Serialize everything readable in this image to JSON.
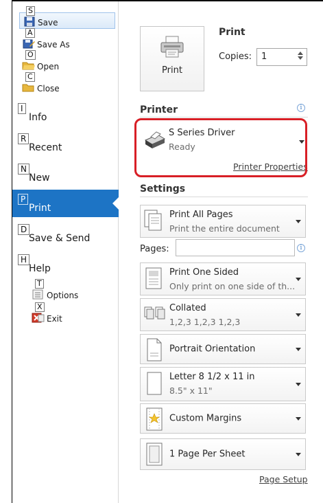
{
  "quick_access": [
    {
      "key": "S",
      "label": "Save",
      "icon": "save-icon",
      "selected": true
    },
    {
      "key": "A",
      "label": "Save As",
      "icon": "save-as-icon"
    },
    {
      "key": "O",
      "label": "Open",
      "icon": "folder-open-icon"
    },
    {
      "key": "C",
      "label": "Close",
      "icon": "folder-close-icon"
    }
  ],
  "nav": [
    {
      "key": "I",
      "label": "Info"
    },
    {
      "key": "R",
      "label": "Recent"
    },
    {
      "key": "N",
      "label": "New"
    },
    {
      "key": "P",
      "label": "Print",
      "active": true
    },
    {
      "key": "D",
      "label": "Save & Send"
    },
    {
      "key": "H",
      "label": "Help"
    }
  ],
  "sub_items": [
    {
      "key": "T",
      "label": "Options",
      "icon": "options-icon"
    },
    {
      "key": "X",
      "label": "Exit",
      "icon": "exit-icon"
    }
  ],
  "print": {
    "button_label": "Print",
    "title": "Print",
    "copies_label": "Copies:",
    "copies_value": "1"
  },
  "printer": {
    "heading": "Printer",
    "info_glyph": "i",
    "name": "S Series Driver",
    "status": "Ready",
    "properties_link": "Printer Properties"
  },
  "settings": {
    "heading": "Settings",
    "print_range": {
      "title": "Print All Pages",
      "subtitle": "Print the entire document"
    },
    "pages_label": "Pages:",
    "pages_value": "",
    "sides": {
      "title": "Print One Sided",
      "subtitle": "Only print on one side of th..."
    },
    "collation": {
      "title": "Collated",
      "subtitle": "1,2,3   1,2,3   1,2,3"
    },
    "orientation": {
      "title": "Portrait Orientation"
    },
    "paper": {
      "title": "Letter 8 1/2 x 11 in",
      "subtitle": "8.5\" x 11\""
    },
    "margins": {
      "title": "Custom Margins"
    },
    "per_sheet": {
      "title": "1 Page Per Sheet"
    },
    "page_setup_link": "Page Setup"
  },
  "colors": {
    "accent": "#1d74c5",
    "highlight": "#d81f26"
  }
}
